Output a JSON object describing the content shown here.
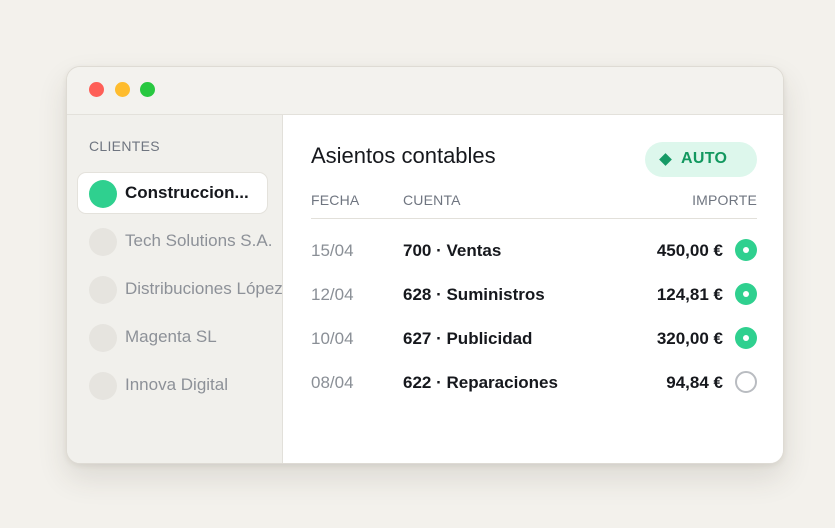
{
  "window": {
    "controls": [
      "close",
      "minimize",
      "zoom"
    ]
  },
  "sidebar": {
    "title": "CLIENTES",
    "clients": [
      {
        "name": "Construccion...",
        "active": true
      },
      {
        "name": "Tech Solutions S.A.",
        "active": false
      },
      {
        "name": "Distribuciones López",
        "active": false
      },
      {
        "name": "Magenta SL",
        "active": false
      },
      {
        "name": "Innova Digital",
        "active": false
      }
    ]
  },
  "main": {
    "title": "Asientos contables",
    "badge": "AUTO",
    "columns": {
      "date": "FECHA",
      "account": "CUENTA",
      "amount": "IMPORTE"
    },
    "entries": [
      {
        "date": "15/04",
        "account": "700 · Ventas",
        "amount": "450,00 €",
        "checked": true
      },
      {
        "date": "12/04",
        "account": "628 · Suministros",
        "amount": "124,81 €",
        "checked": true
      },
      {
        "date": "10/04",
        "account": "627 · Publicidad",
        "amount": "320,00 €",
        "checked": true
      },
      {
        "date": "08/04",
        "account": "622 · Reparaciones",
        "amount": "94,84 €",
        "checked": false
      }
    ]
  },
  "colors": {
    "accent": "#2fd08f",
    "badge_bg": "#ddf7ec",
    "badge_text": "#12985f"
  }
}
